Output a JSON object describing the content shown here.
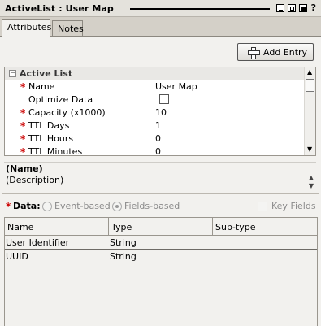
{
  "window": {
    "title": "ActiveList : User Map",
    "help_glyph": "?"
  },
  "tabs": [
    {
      "label": "Attributes",
      "active": true
    },
    {
      "label": "Notes",
      "active": false
    }
  ],
  "toolbar": {
    "add_entry_label": "Add Entry"
  },
  "properties": {
    "section_title": "Active List",
    "rows": [
      {
        "name": "Name",
        "required": true,
        "value": "User Map"
      },
      {
        "name": "Optimize Data",
        "required": false,
        "value": "",
        "checkbox": true,
        "checked": false
      },
      {
        "name": "Capacity (x1000)",
        "required": true,
        "value": "10"
      },
      {
        "name": "TTL Days",
        "required": true,
        "value": "1"
      },
      {
        "name": "TTL Hours",
        "required": true,
        "value": "0"
      },
      {
        "name": "TTL Minutes",
        "required": true,
        "value": "0"
      }
    ]
  },
  "description": {
    "name": "(Name)",
    "text": "(Description)"
  },
  "data_section": {
    "label": "Data:",
    "option_event": "Event-based",
    "option_fields": "Fields-based",
    "selected": "Fields-based",
    "key_fields_label": "Key Fields"
  },
  "table": {
    "columns": [
      "Name",
      "Type",
      "Sub-type"
    ],
    "rows": [
      [
        "User Identifier",
        "String",
        ""
      ],
      [
        "UUID",
        "String",
        ""
      ]
    ]
  },
  "colors": {
    "required_star": "#cc0000",
    "window_bg": "#d4d0c8",
    "panel_bg": "#f2f1ee"
  }
}
